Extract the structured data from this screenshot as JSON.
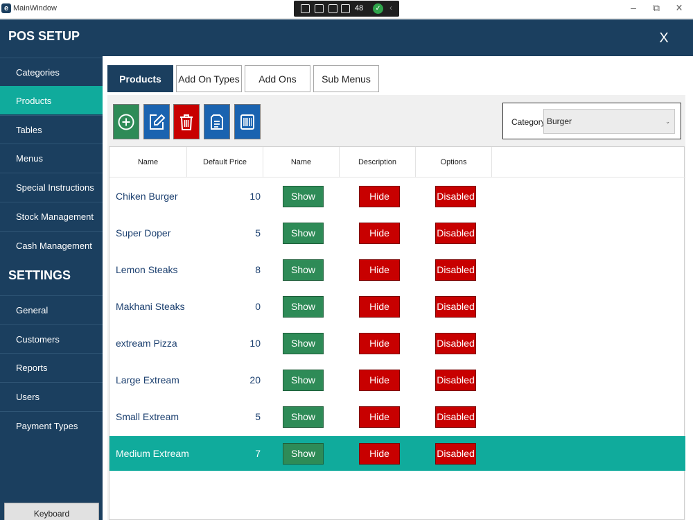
{
  "window": {
    "title": "MainWindow",
    "debug_count": "48",
    "controls": {
      "minimize": "–",
      "restore": "⧉",
      "close": "✕"
    }
  },
  "header": {
    "title": "POS SETUP",
    "close_label": "X"
  },
  "sidebar": {
    "setup_items": [
      {
        "label": "Categories",
        "active": false
      },
      {
        "label": "Products",
        "active": true
      },
      {
        "label": "Tables",
        "active": false
      },
      {
        "label": "Menus",
        "active": false
      },
      {
        "label": "Special Instructions",
        "active": false
      },
      {
        "label": "Stock Management",
        "active": false
      },
      {
        "label": "Cash Management",
        "active": false
      }
    ],
    "settings_title": "SETTINGS",
    "settings_items": [
      {
        "label": "General"
      },
      {
        "label": "Customers"
      },
      {
        "label": "Reports"
      },
      {
        "label": "Users"
      },
      {
        "label": "Payment Types"
      }
    ],
    "keyboard_label": "Keyboard"
  },
  "tabs": [
    {
      "label": "Products",
      "active": true
    },
    {
      "label": "Add On Types",
      "active": false
    },
    {
      "label": "Add Ons",
      "active": false
    },
    {
      "label": "Sub Menus",
      "active": false
    }
  ],
  "toolbar": {
    "buttons": [
      {
        "name": "add",
        "icon": "plus-circle-icon",
        "color": "#2e8b57"
      },
      {
        "name": "edit",
        "icon": "edit-icon",
        "color": "#1a63b0"
      },
      {
        "name": "delete",
        "icon": "trash-icon",
        "color": "#c80000"
      },
      {
        "name": "copy",
        "icon": "document-icon",
        "color": "#1a63b0"
      },
      {
        "name": "barcode",
        "icon": "barcode-icon",
        "color": "#1a63b0"
      }
    ]
  },
  "category": {
    "label": "Category:",
    "value": "Burger"
  },
  "grid": {
    "columns": [
      "Name",
      "Default Price",
      "Name",
      "Description",
      "Options"
    ],
    "rows": [
      {
        "name": "Chiken Burger",
        "price": "10",
        "show": "Show",
        "hide": "Hide",
        "options": "Disabled",
        "selected": false
      },
      {
        "name": "Super Doper",
        "price": "5",
        "show": "Show",
        "hide": "Hide",
        "options": "Disabled",
        "selected": false
      },
      {
        "name": "Lemon Steaks",
        "price": "8",
        "show": "Show",
        "hide": "Hide",
        "options": "Disabled",
        "selected": false
      },
      {
        "name": "Makhani Steaks",
        "price": "0",
        "show": "Show",
        "hide": "Hide",
        "options": "Disabled",
        "selected": false
      },
      {
        "name": "extream Pizza",
        "price": "10",
        "show": "Show",
        "hide": "Hide",
        "options": "Disabled",
        "selected": false
      },
      {
        "name": "Large Extream",
        "price": "20",
        "show": "Show",
        "hide": "Hide",
        "options": "Disabled",
        "selected": false
      },
      {
        "name": "Small Extream",
        "price": "5",
        "show": "Show",
        "hide": "Hide",
        "options": "Disabled",
        "selected": false
      },
      {
        "name": "Medium Extream",
        "price": "7",
        "show": "Show",
        "hide": "Hide",
        "options": "Disabled",
        "selected": true
      }
    ]
  },
  "colors": {
    "primary": "#1b3f5f",
    "accent": "#10ab9c",
    "show": "#2e8b57",
    "danger": "#c80000"
  }
}
